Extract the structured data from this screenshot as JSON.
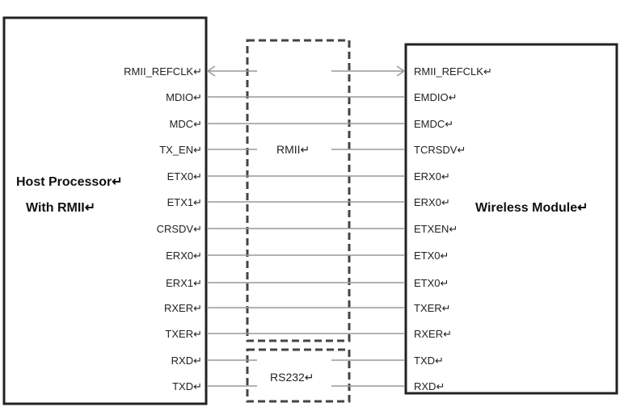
{
  "host": {
    "title_line1": "Host Processor↵",
    "title_line2": "With RMII↵"
  },
  "module": {
    "title": "Wireless Module↵"
  },
  "rmii_label": "RMII↵",
  "rs232_label": "RS232↵",
  "signals": [
    {
      "left": "RMII_REFCLK↵",
      "right": "RMII_REFCLK↵",
      "style": "arrows"
    },
    {
      "left": "MDIO↵",
      "right": "EMDIO↵",
      "style": "line"
    },
    {
      "left": "MDC↵",
      "right": "EMDC↵",
      "style": "line"
    },
    {
      "left": "TX_EN↵",
      "right": "TCRSDV↵",
      "style": "split"
    },
    {
      "left": "ETX0↵",
      "right": "ERX0↵",
      "style": "line"
    },
    {
      "left": "ETX1↵",
      "right": "ERX0↵",
      "style": "line"
    },
    {
      "left": "CRSDV↵",
      "right": "ETXEN↵",
      "style": "line"
    },
    {
      "left": "ERX0↵",
      "right": "ETX0↵",
      "style": "line"
    },
    {
      "left": "ERX1↵",
      "right": "ETX0↵",
      "style": "line"
    },
    {
      "left": "RXER↵",
      "right": "TXER↵",
      "style": "line"
    },
    {
      "left": "TXER↵",
      "right": "RXER↵",
      "style": "line"
    },
    {
      "left": "RXD↵",
      "right": "TXD↵",
      "style": "split"
    },
    {
      "left": "TXD↵",
      "right": "RXD↵",
      "style": "split"
    }
  ]
}
